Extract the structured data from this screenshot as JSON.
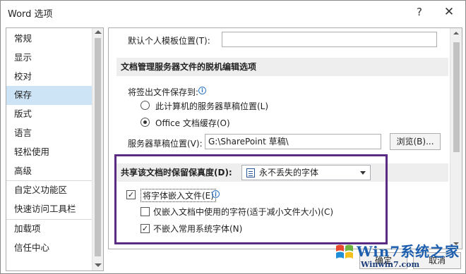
{
  "window": {
    "title": "Word 选项",
    "help_label": "?",
    "close_label": "✕"
  },
  "nav": {
    "items": [
      {
        "label": "常规"
      },
      {
        "label": "显示"
      },
      {
        "label": "校对"
      },
      {
        "label": "保存",
        "selected": true
      },
      {
        "label": "版式"
      },
      {
        "label": "语言"
      },
      {
        "label": "轻松使用"
      },
      {
        "label": "高级"
      },
      {
        "label": "自定义功能区"
      },
      {
        "label": "快速访问工具栏"
      },
      {
        "label": "加载项"
      },
      {
        "label": "信任中心"
      }
    ]
  },
  "main": {
    "default_template_label": "默认个人模板位置(T):",
    "default_template_value": "",
    "offline_section_title": "文档管理服务器文件的脱机编辑选项",
    "checkout_label": "将签出文件保存到:",
    "radio_server_drafts": "此计算机的服务器草稿位置(L)",
    "radio_office_cache": "Office 文档缓存(O)",
    "server_drafts_label": "服务器草稿位置(V):",
    "server_drafts_value": "G:\\SharePoint 草稿\\",
    "browse_label": "浏览(B)...",
    "fidelity_label": "共享该文档时保留保真度(D):",
    "fidelity_doc_value": "永不丢失的字体",
    "embed_fonts_label": "将字体嵌入文件(E)",
    "embed_used_chars_label": "仅嵌入文档中使用的字符(适于减小文件大小)(C)",
    "no_common_fonts_label": "不嵌入常用系统字体(N)",
    "embed_fonts_checked": true,
    "embed_used_chars_checked": false,
    "no_common_fonts_checked": true
  },
  "footer": {
    "ok_label": "确定",
    "cancel_label": "取消"
  },
  "watermark": {
    "main": "Win7系统之家",
    "sub": "Winwin7.com"
  },
  "colors": {
    "highlight_border": "#5b2a82",
    "nav_selected": "#cde4f7",
    "info_blue": "#2e75c7"
  }
}
